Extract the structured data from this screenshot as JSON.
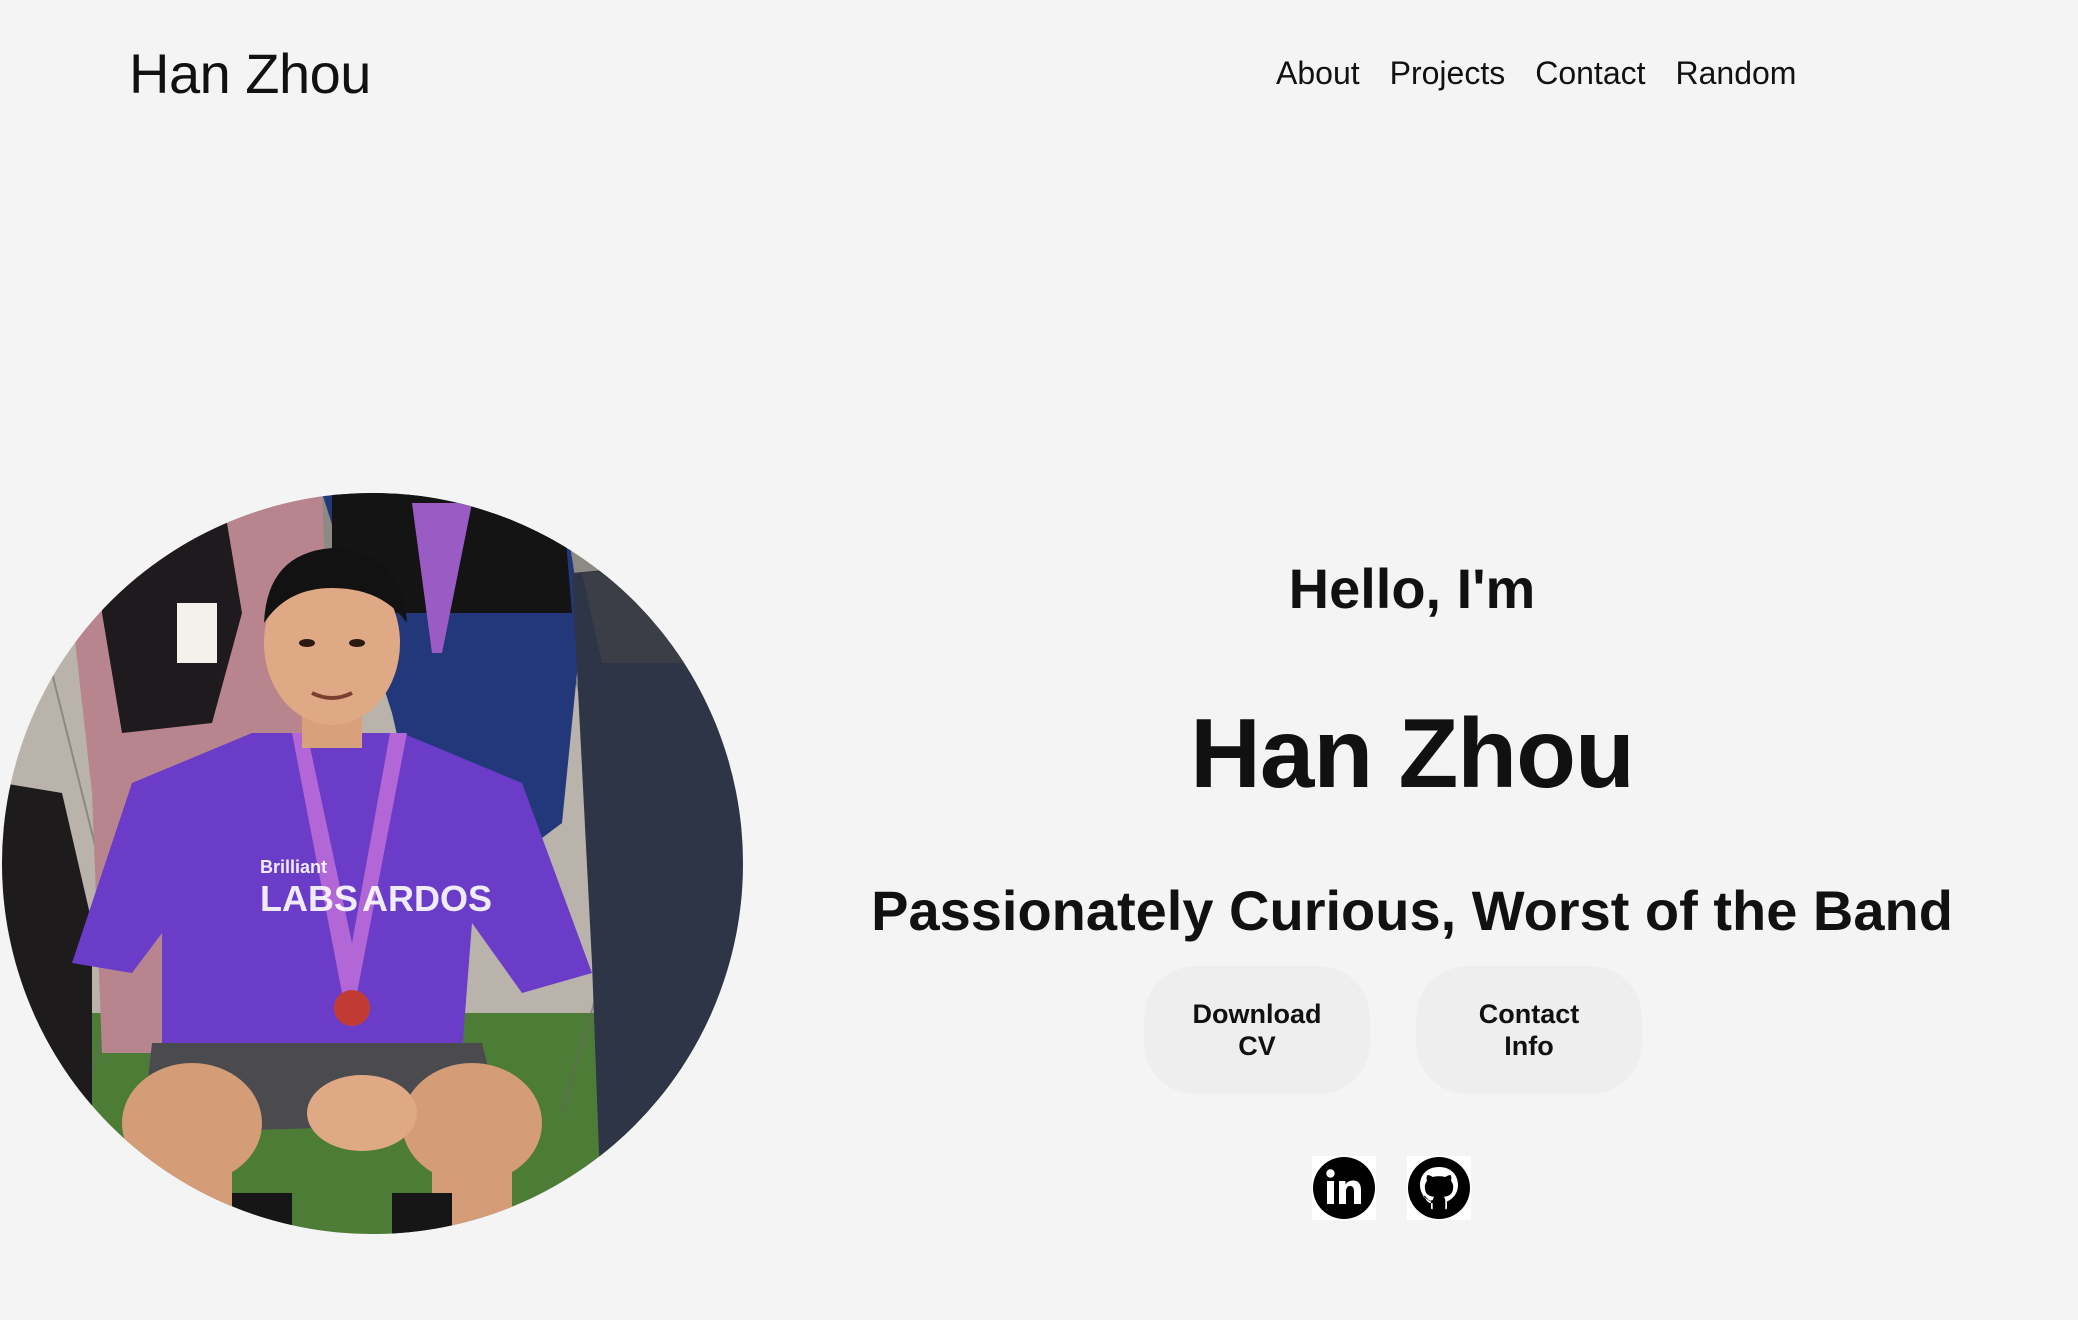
{
  "header": {
    "site_title": "Han Zhou",
    "nav": [
      {
        "label": "About"
      },
      {
        "label": "Projects"
      },
      {
        "label": "Contact"
      },
      {
        "label": "Random"
      }
    ]
  },
  "hero": {
    "greeting": "Hello, I'm",
    "name": "Han Zhou",
    "tagline": "Passionately Curious, Worst of the Band",
    "buttons": {
      "download_cv": "Download CV",
      "contact_info": "Contact Info"
    },
    "socials": [
      {
        "icon": "linkedin-icon"
      },
      {
        "icon": "github-icon"
      }
    ]
  },
  "profile_photo": {
    "shirt_text": "Brilliant LABS ARDOS"
  },
  "colors": {
    "background": "#f4f4f4",
    "text": "#111111",
    "button_bg": "#eeeeee",
    "shirt_purple": "#6a3cc8"
  }
}
